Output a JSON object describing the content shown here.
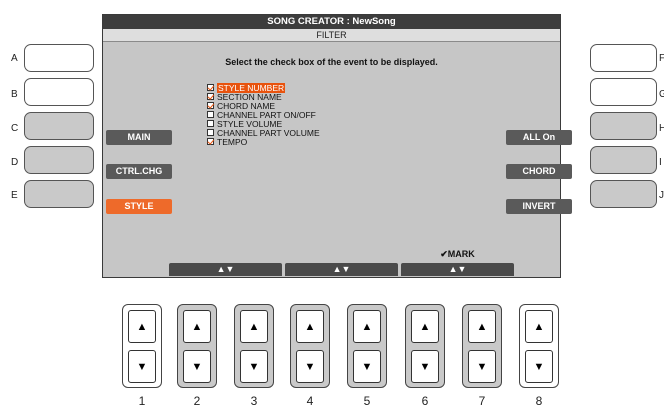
{
  "screen": {
    "title": "SONG CREATOR : NewSong",
    "subtitle": "FILTER",
    "instruction": "Select the check box of the event to be displayed.",
    "options": [
      {
        "label": "STYLE NUMBER",
        "checked": true,
        "selected": true
      },
      {
        "label": "SECTION NAME",
        "checked": true,
        "selected": false
      },
      {
        "label": "CHORD NAME",
        "checked": true,
        "selected": false
      },
      {
        "label": "CHANNEL PART ON/OFF",
        "checked": false,
        "selected": false
      },
      {
        "label": "STYLE VOLUME",
        "checked": false,
        "selected": false
      },
      {
        "label": "CHANNEL PART VOLUME",
        "checked": false,
        "selected": false
      },
      {
        "label": "TEMPO",
        "checked": true,
        "selected": false
      }
    ],
    "left_buttons": {
      "main": "MAIN",
      "ctrl_chg": "CTRL.CHG",
      "style": "STYLE"
    },
    "right_buttons": {
      "all_on": "ALL On",
      "chord": "CHORD",
      "invert": "INVERT"
    },
    "bottom_tabs": [
      "▲▼",
      "▲▼",
      "▲▼"
    ],
    "mark_label": "✔MARK",
    "accent_color": "#ee6a2a"
  },
  "side_letters": {
    "left": [
      "A",
      "B",
      "C",
      "D",
      "E"
    ],
    "right": [
      "F",
      "G",
      "H",
      "I",
      "J"
    ]
  },
  "panel_numbers": [
    "1",
    "2",
    "3",
    "4",
    "5",
    "6",
    "7",
    "8"
  ],
  "updown_glyphs": {
    "up": "▲",
    "down": "▼"
  }
}
